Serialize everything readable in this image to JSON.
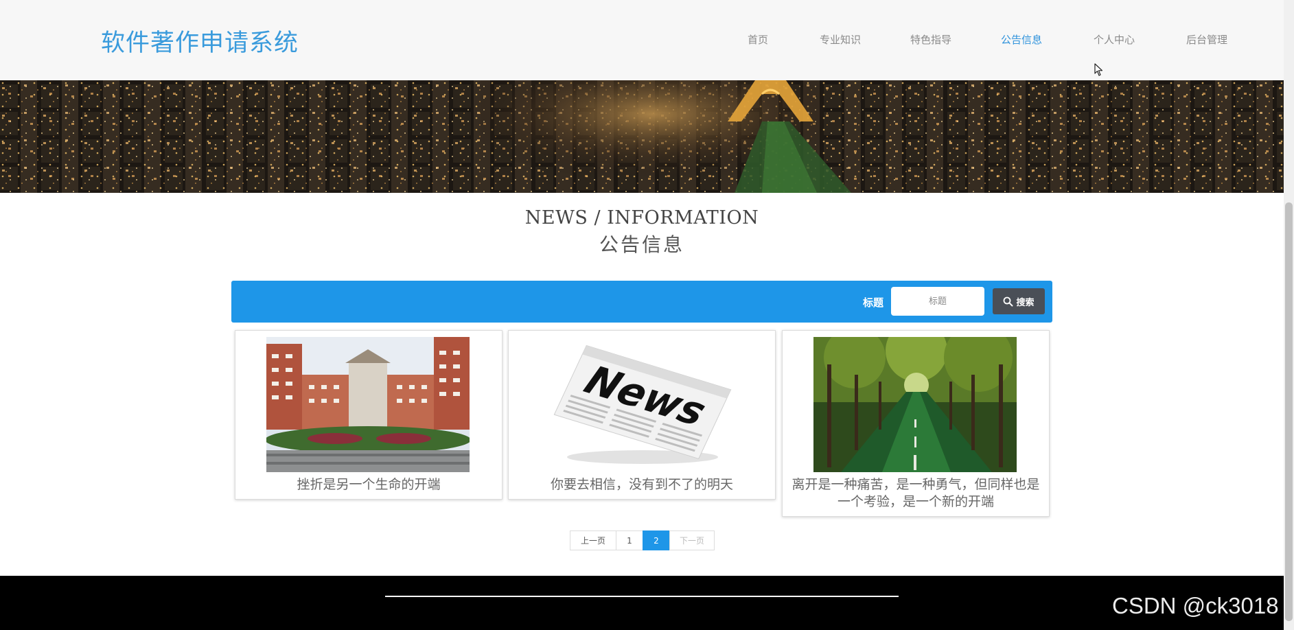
{
  "header": {
    "site_title": "软件著作申请系统",
    "nav": [
      {
        "label": "首页",
        "active": false
      },
      {
        "label": "专业知识",
        "active": false
      },
      {
        "label": "特色指导",
        "active": false
      },
      {
        "label": "公告信息",
        "active": true
      },
      {
        "label": "个人中心",
        "active": false
      },
      {
        "label": "后台管理",
        "active": false
      }
    ]
  },
  "section": {
    "title_en": "NEWS / INFORMATION",
    "title_cn": "公告信息"
  },
  "search": {
    "label": "标题",
    "placeholder": "标题",
    "button_label": "搜索"
  },
  "cards": [
    {
      "title": "挫折是另一个生命的开端",
      "image": "campus-building-photo"
    },
    {
      "title": "你要去相信，没有到不了的明天",
      "image": "newspaper-news-photo"
    },
    {
      "title": "离开是一种痛苦，是一种勇气，但同样也是一个考验，是一个新的开端",
      "image": "tree-lined-road-photo"
    }
  ],
  "pagination": {
    "prev_label": "上一页",
    "pages": [
      "1",
      "2"
    ],
    "current_page": "2",
    "next_label": "下一页"
  },
  "watermark": "CSDN @ck3018",
  "colors": {
    "accent": "#1e96e8",
    "title_blue": "#3a9bdc",
    "nav_active": "#2f93dc",
    "search_button": "#4a4f57",
    "footer": "#000000"
  }
}
